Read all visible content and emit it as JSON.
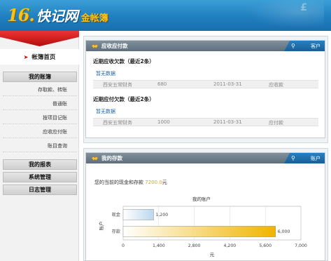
{
  "header": {
    "logo_mark": "16.",
    "logo_text": "快记网",
    "logo_sub": "金帐簿",
    "accent": "#f6c21b",
    "bg": "#1f7fc0"
  },
  "sidebar": {
    "home_label": "帐簿首页",
    "sections": [
      {
        "label": "我的账簿",
        "items": [
          "存取款、转账",
          "普通账",
          "按项目记账",
          "应收应付账",
          "账目查询"
        ]
      },
      {
        "label": "我的报表",
        "items": []
      },
      {
        "label": "系统管理",
        "items": []
      },
      {
        "label": "日志管理",
        "items": []
      }
    ]
  },
  "receivables": {
    "title": "应收应付款",
    "tab_label": "客户",
    "recv_title": "近期应收欠款（最近2条）",
    "recv_nodata": "暂无数据",
    "recv_row": [
      "西安五常财务",
      "680",
      "2011-03-31",
      "应收款"
    ],
    "pay_title": "近期应付欠款（最近2条）",
    "pay_nodata": "暂无数据",
    "pay_row": [
      "西安五常财务",
      "1000",
      "2011-03-31",
      "应付款"
    ]
  },
  "deposits": {
    "title": "我的存款",
    "tab_label": "账户",
    "balance_prefix": "您的当前的现金和存款",
    "balance_amount": "7200.0",
    "balance_suffix": "元"
  },
  "chart_data": {
    "type": "bar",
    "orientation": "horizontal",
    "title": "我的账户",
    "ylabel": "账户",
    "xlabel": "元",
    "categories": [
      "现金",
      "存款"
    ],
    "values": [
      1200,
      6000
    ],
    "value_labels": [
      "1,200",
      "6,000"
    ],
    "xlim": [
      0,
      7000
    ],
    "xticks": [
      0,
      1400,
      2800,
      4200,
      5600,
      7000
    ],
    "xtick_labels": [
      "0",
      "1,400",
      "2,800",
      "4,200",
      "5,600",
      "7,000"
    ],
    "colors": [
      "#bcd7ee",
      "#f0b400"
    ],
    "grid": true
  }
}
